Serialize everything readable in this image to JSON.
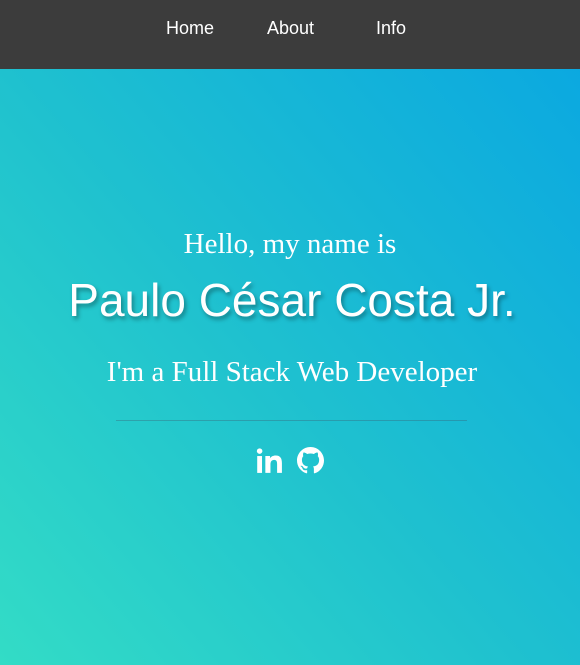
{
  "nav": {
    "items": [
      {
        "label": "Home"
      },
      {
        "label": "About"
      },
      {
        "label": "Info"
      }
    ],
    "background": "#3c3c3c"
  },
  "hero": {
    "greeting": "Hello, my name is",
    "name": "Paulo César Costa Jr.",
    "role": "I'm a Full Stack Web Developer",
    "gradient_colors": [
      "#33dcc6",
      "#09a6e2"
    ]
  },
  "socials": {
    "icons": [
      "linkedin-icon",
      "github-icon"
    ]
  }
}
